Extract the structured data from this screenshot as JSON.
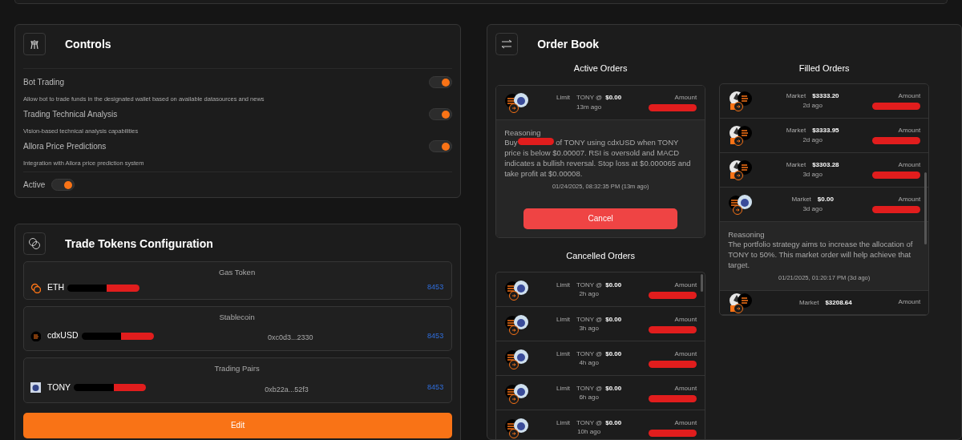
{
  "controls": {
    "title": "Controls",
    "settings": [
      {
        "label": "Bot Trading",
        "description": "Allow bot to trade funds in the designated wallet based on available datasources and news",
        "on": true
      },
      {
        "label": "Trading Technical Analysis",
        "description": "Vision-based technical analysis capabilities",
        "on": true
      },
      {
        "label": "Allora Price Predictions",
        "description": "Integration with Allora price prediction system",
        "on": true
      }
    ],
    "active": {
      "label": "Active",
      "on": true
    }
  },
  "trade_tokens": {
    "title": "Trade Tokens Configuration",
    "groups": [
      {
        "heading": "Gas Token",
        "kind": "coins",
        "symbol": "ETH",
        "redacted": true,
        "chain": "8453"
      },
      {
        "heading": "Stablecoin",
        "kind": "stable",
        "symbol": "cdxUSD",
        "redacted": true,
        "address": "0xc0d3...2330",
        "chain": "8453"
      },
      {
        "heading": "Trading Pairs",
        "kind": "avatar",
        "symbol": "TONY",
        "redacted": true,
        "address": "0xb22a...52f3",
        "chain": "8453"
      }
    ],
    "button": "Edit"
  },
  "order_book": {
    "title": "Order Book",
    "active_orders": {
      "heading": "Active Orders",
      "orders": [
        {
          "kind": "tony",
          "type": "Limit",
          "pair": "TONY @",
          "price": "$0.00",
          "time": "13m ago",
          "amount_label": "Amount",
          "redacted": true,
          "expanded": true,
          "reasoning_label": "Reasoning",
          "reasoning_start": "Buy",
          "reasoning_end": "of TONY using cdxUSD when TONY price is below $0.00007. RSI is oversold and MACD indicates a bullish reversal. Stop loss at $0.000065 and take profit at $0.00008.",
          "timestamp": "01/24/2025, 08:32:35 PM (13m ago)",
          "button": "Cancel"
        }
      ]
    },
    "cancelled_orders": {
      "heading": "Cancelled Orders",
      "orders": [
        {
          "kind": "tony",
          "type": "Limit",
          "pair": "TONY @",
          "price": "$0.00",
          "time": "2h ago",
          "amount_label": "Amount",
          "redacted": true,
          "expanded": false
        },
        {
          "kind": "tony",
          "type": "Limit",
          "pair": "TONY @",
          "price": "$0.00",
          "time": "3h ago",
          "amount_label": "Amount",
          "redacted": true,
          "expanded": false
        },
        {
          "kind": "tony",
          "type": "Limit",
          "pair": "TONY @",
          "price": "$0.00",
          "time": "4h ago",
          "amount_label": "Amount",
          "redacted": true,
          "expanded": false
        },
        {
          "kind": "tony",
          "type": "Limit",
          "pair": "TONY @",
          "price": "$0.00",
          "time": "6h ago",
          "amount_label": "Amount",
          "redacted": true,
          "expanded": false
        },
        {
          "kind": "tony",
          "type": "Limit",
          "pair": "TONY @",
          "price": "$0.00",
          "time": "10h ago",
          "amount_label": "Amount",
          "redacted": true,
          "expanded": false
        }
      ]
    },
    "filled_orders": {
      "heading": "Filled Orders",
      "orders": [
        {
          "kind": "eth",
          "type": "Market",
          "price": "$3333.20",
          "time": "2d ago",
          "amount_label": "Amount",
          "redacted": true,
          "expanded": false
        },
        {
          "kind": "eth",
          "type": "Market",
          "price": "$3333.95",
          "time": "2d ago",
          "amount_label": "Amount",
          "redacted": true,
          "expanded": false
        },
        {
          "kind": "eth",
          "type": "Market",
          "price": "$3303.28",
          "time": "3d ago",
          "amount_label": "Amount",
          "redacted": true,
          "expanded": false
        },
        {
          "kind": "tony",
          "type": "Market",
          "price": "$0.00",
          "time": "3d ago",
          "amount_label": "Amount",
          "redacted": true,
          "expanded": true,
          "reasoning_label": "Reasoning",
          "reasoning_end": "The portfolio strategy aims to increase the allocation of TONY to 50%. This market order will help achieve that target.",
          "timestamp": "01/21/2025, 01:20:17 PM (3d ago)"
        },
        {
          "kind": "eth",
          "type": "Market",
          "price": "$3208.64",
          "amount_label": "Amount",
          "redacted": false,
          "expanded": false
        }
      ]
    }
  }
}
